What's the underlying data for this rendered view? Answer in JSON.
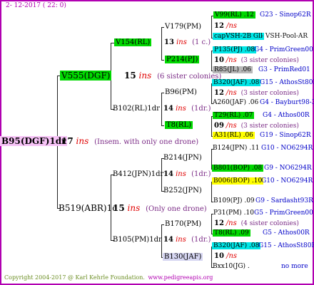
{
  "header": {
    "date": "2- 12-2017 ( 22: 0)"
  },
  "footer": {
    "copyright": "Copyright 2004-2017 @ Karl Kehrle Foundation.",
    "site": "www.pedigreeapis.org"
  },
  "root": {
    "label": "B95(DGF)1dr",
    "ins_count": "17",
    "ins": "ins",
    "note": "(Insem. with only one drone)"
  },
  "sire": {
    "label": "V555(DGF)",
    "ins_count": "15",
    "ins": "ins",
    "note": "(6 sister colonies)"
  },
  "dam": {
    "label": "B519(ABR)1c",
    "ins_count": "15",
    "ins": "ins",
    "note": "(Only one drone)"
  },
  "gen3": {
    "v154": {
      "label": "V154(RL)",
      "ins_count": "13",
      "ins": "ins",
      "note": "(1 c.)"
    },
    "b102": {
      "label": "B102(RL)1dr",
      "ins_count": "14",
      "ins": "ins",
      "note": "(1dr.)"
    },
    "b412": {
      "label": "B412(JPN)1dr",
      "ins_count": "14",
      "ins": "ins",
      "note": "(1dr.)"
    },
    "b105": {
      "label": "B105(PM)1dr",
      "ins_count": "14",
      "ins": "ins",
      "note": "(1dr.)"
    }
  },
  "gen4": {
    "v179": "V179(PM)",
    "p214": "P214(PJ)",
    "b96": "B96(PM)",
    "t8": "T8(RL)",
    "b214": "B214(JPN)",
    "b252": "B252(JPN)",
    "b170": "B170(PM)",
    "b130": "B130(JAF)"
  },
  "gen5": {
    "r1": {
      "label": "V99(RL) .12",
      "right": "G23 - Sinop62R"
    },
    "r2": {
      "count": "12",
      "ins": "/ns"
    },
    "r3": {
      "label": "capVSH-2B Gll",
      "right": "- VSH-Pool-AR"
    },
    "r4": {
      "label": "P135(PJ) .08",
      "right": "G4 - PrimGreen00"
    },
    "r5": {
      "count": "10",
      "ins": "/ns",
      "note": "(3 sister colonies)"
    },
    "r6": {
      "label": "R85(JL) .06",
      "right": "G3 - PrimRed01"
    },
    "r7": {
      "label": "B320(JAF) .08",
      "right": "G15 - AthosSt80R"
    },
    "r8": {
      "count": "12",
      "ins": "/ns",
      "note": "(3 sister colonies)"
    },
    "r9": {
      "label": "A260(JAF) .06",
      "right": "G4 - Bayburt98-3"
    },
    "r10": {
      "label": "T29(RL) .07",
      "right": "G4 - Athos00R"
    },
    "r11": {
      "count": "09",
      "ins": "/ns",
      "note": "(3 sister colonies)"
    },
    "r12": {
      "label": "A31(RL) .06",
      "right": "G19 - Sinop62R"
    },
    "r13": {
      "label": "B124(JPN) .11",
      "right": "G10 - NO6294R"
    },
    "r14": {
      "label": "B801(BOP) .08",
      "right": "G9 - NO6294R"
    },
    "r15": {
      "label": "B006(BOP) .10",
      "right": "G10 - NO6294R"
    },
    "r16": {
      "label": "B109(PJ) .09",
      "right": "G9 - Sardasht93R"
    },
    "r17": {
      "label": "P31(PM) .10",
      "right": "G5 - PrimGreen00"
    },
    "r18": {
      "count": "12",
      "ins": "/ns",
      "note": "(4 sister colonies)"
    },
    "r19": {
      "label": "T8(RL) .09",
      "right": "G5 - Athos00R"
    },
    "r20": {
      "label": "B320(JAF) .08",
      "right": "G15 - AthosSt80R"
    },
    "r21": {
      "count": "10",
      "ins": "/ns"
    },
    "r22": {
      "label": "Bxx10(JG) .",
      "right": "no more"
    }
  }
}
